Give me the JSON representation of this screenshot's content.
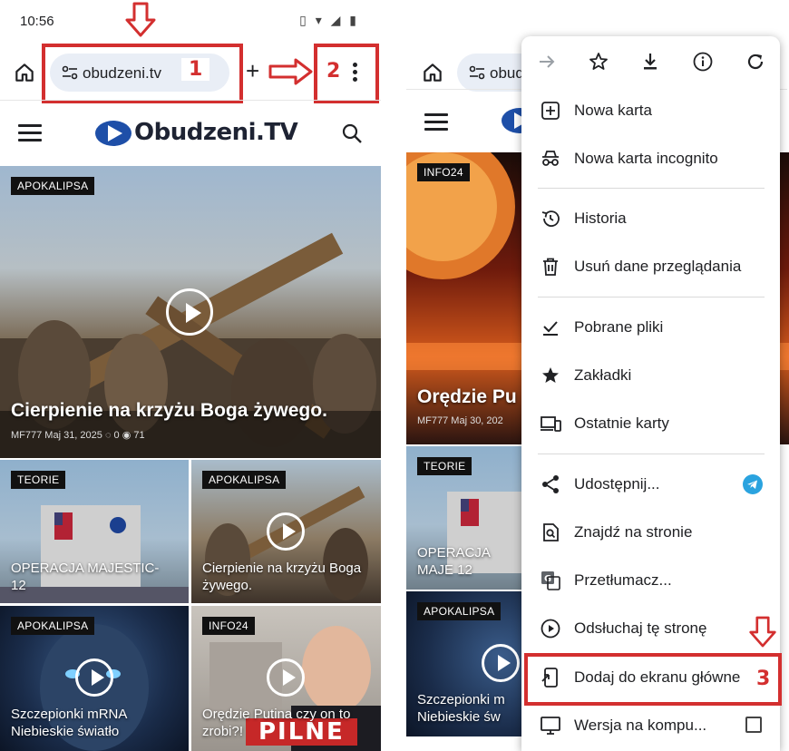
{
  "status": {
    "time": "10:56",
    "icons_text": "▯ ▾ ◢ ▮"
  },
  "toolbar": {
    "url": "obudzeni.tv",
    "url_short": "obud",
    "new_tab_label": "+"
  },
  "annotations": {
    "n1": "1",
    "n2": "2",
    "n3": "3",
    "arrow_down": "⇩",
    "arrow_right": "⇨"
  },
  "site": {
    "logo": "Obudzeni.TV"
  },
  "articles": {
    "main": {
      "tag": "APOKALIPSA",
      "title": "Cierpienie na krzyżu Boga żywego.",
      "meta": "MF777   Maj 31, 2025   ◌ 0   ◉ 71"
    },
    "grid": [
      {
        "tag": "TEORIE",
        "title": "OPERACJA MAJESTIC-12"
      },
      {
        "tag": "APOKALIPSA",
        "title": "Cierpienie na krzyżu Boga żywego."
      },
      {
        "tag": "APOKALIPSA",
        "title": "Szczepionki mRNA Niebieskie światło"
      },
      {
        "tag": "INFO24",
        "title": "Orędzie Putina czy on to zrobi?!",
        "overlay": "PILNE"
      }
    ],
    "right_main": {
      "tag": "INFO24",
      "title": "Orędzie Pu",
      "meta": "MF777   Maj 30, 202"
    },
    "right_grid": [
      {
        "tag": "TEORIE",
        "title": "OPERACJA MAJE 12"
      },
      {
        "tag": "APOKALIPSA",
        "title": "Szczepionki m Niebieskie św"
      }
    ]
  },
  "menu": {
    "top_icons": [
      "arrow-forward-icon",
      "star-icon",
      "download-icon",
      "info-icon",
      "refresh-icon"
    ],
    "items": [
      {
        "icon": "plus-box-icon",
        "label": "Nowa karta"
      },
      {
        "icon": "incognito-icon",
        "label": "Nowa karta incognito"
      },
      {
        "icon": "history-icon",
        "label": "Historia"
      },
      {
        "icon": "trash-icon",
        "label": "Usuń dane przeglądania"
      },
      {
        "icon": "download-done-icon",
        "label": "Pobrane pliki"
      },
      {
        "icon": "star-filled-icon",
        "label": "Zakładki"
      },
      {
        "icon": "devices-icon",
        "label": "Ostatnie karty"
      },
      {
        "icon": "share-icon",
        "label": "Udostępnij..."
      },
      {
        "icon": "find-in-page-icon",
        "label": "Znajdź na stronie"
      },
      {
        "icon": "translate-icon",
        "label": "Przetłumacz..."
      },
      {
        "icon": "play-circle-icon",
        "label": "Odsłuchaj tę stronę"
      },
      {
        "icon": "add-home-icon",
        "label": "Dodaj do ekranu główne"
      },
      {
        "icon": "desktop-icon",
        "label": "Wersja na kompu..."
      }
    ]
  },
  "colors": {
    "annotation": "#d32f2f",
    "url_pill": "#e9eef6",
    "logo_blue": "#1e4fa8"
  }
}
